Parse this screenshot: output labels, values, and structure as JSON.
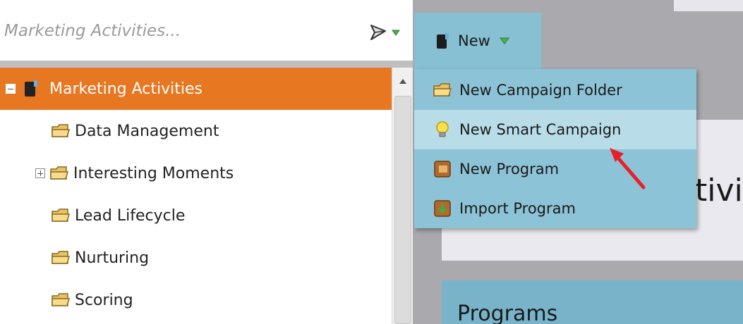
{
  "search": {
    "placeholder": "Marketing Activities..."
  },
  "tree": {
    "items": [
      {
        "label": "Marketing Activities",
        "icon": "marketing-activities-icon",
        "expander": "minus",
        "selected": true
      },
      {
        "label": "Data Management",
        "icon": "folder-icon"
      },
      {
        "label": "Interesting Moments",
        "icon": "folder-icon",
        "expander": "plus"
      },
      {
        "label": "Lead Lifecycle",
        "icon": "folder-icon"
      },
      {
        "label": "Nurturing",
        "icon": "folder-icon"
      },
      {
        "label": "Scoring",
        "icon": "folder-icon"
      }
    ]
  },
  "toolbar": {
    "new_label": "New"
  },
  "new_menu": {
    "items": [
      {
        "label": "New Campaign Folder",
        "icon": "folder-icon"
      },
      {
        "label": "New Smart Campaign",
        "icon": "lightbulb-icon",
        "highlighted": true
      },
      {
        "label": "New Program",
        "icon": "program-icon"
      },
      {
        "label": "Import Program",
        "icon": "import-program-icon"
      }
    ]
  },
  "main": {
    "title_fragment": "tivit",
    "programs_heading": "Programs"
  },
  "colors": {
    "selected_row": "#e87722",
    "menu_background": "#8dc3d6",
    "menu_highlight": "#b8dde8",
    "annotation_arrow": "#e8202a"
  }
}
